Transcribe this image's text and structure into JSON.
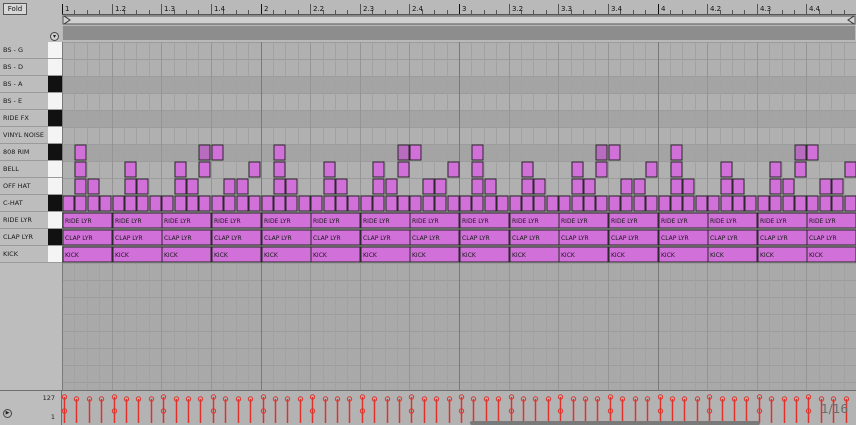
{
  "fold_label": "Fold",
  "fold_circle_icon": "filter-icon",
  "bar_labels": [
    "1",
    "1.2",
    "1.3",
    "1.4",
    "2",
    "2.2",
    "2.3",
    "2.4",
    "3",
    "3.2",
    "3.3",
    "3.4",
    "4",
    "4.2",
    "4.3",
    "4.4"
  ],
  "rows": [
    {
      "name": "BS - G",
      "key": "white"
    },
    {
      "name": "BS - D",
      "key": "white"
    },
    {
      "name": "BS - A",
      "key": "black"
    },
    {
      "name": "BS - E",
      "key": "white"
    },
    {
      "name": "RIDE FX",
      "key": "black"
    },
    {
      "name": "VINYL NOISE",
      "key": "white"
    },
    {
      "name": "808 RIM",
      "key": "black"
    },
    {
      "name": "BELL",
      "key": "white"
    },
    {
      "name": "OFF HAT",
      "key": "white"
    },
    {
      "name": "C-HAT",
      "key": "black"
    },
    {
      "name": "RIDE LYR",
      "key": "white"
    },
    {
      "name": "CLAP LYR",
      "key": "black"
    },
    {
      "name": "KICK",
      "key": "white"
    }
  ],
  "note_labels": {
    "ride_lyr": "RIDE LYR",
    "clap_lyr": "CLAP LYR",
    "kick": "KICK"
  },
  "pattern": {
    "steps_per_bar": 16,
    "bars": 4,
    "c_hat_steps": [
      0,
      1,
      2,
      3,
      4,
      5,
      6,
      7,
      8,
      9,
      10,
      11,
      12,
      13,
      14,
      15
    ],
    "long_note_every_steps": 4,
    "rim_steps_per_bar": [
      1,
      12
    ],
    "rim_dense_steps_per_bar": [
      11
    ],
    "bell_steps_per_bar": [
      1,
      5,
      9,
      11,
      15
    ],
    "bell_high_steps_per_bar": [
      1,
      5,
      9
    ],
    "offhat_steps_per_bar": [
      2,
      6,
      10,
      14
    ],
    "bell_low_steps_per_bar": [
      2,
      6,
      10,
      14
    ]
  },
  "velocity": {
    "max_label": "127",
    "min_label": "1"
  },
  "quantize_label": "1/16",
  "colors": {
    "note_fill": "#d070d8",
    "note_stroke": "#2a2a2a",
    "velocity": "#e0322a",
    "grid_light": "#b0b0b0",
    "grid_dark": "#a4a4a4"
  }
}
